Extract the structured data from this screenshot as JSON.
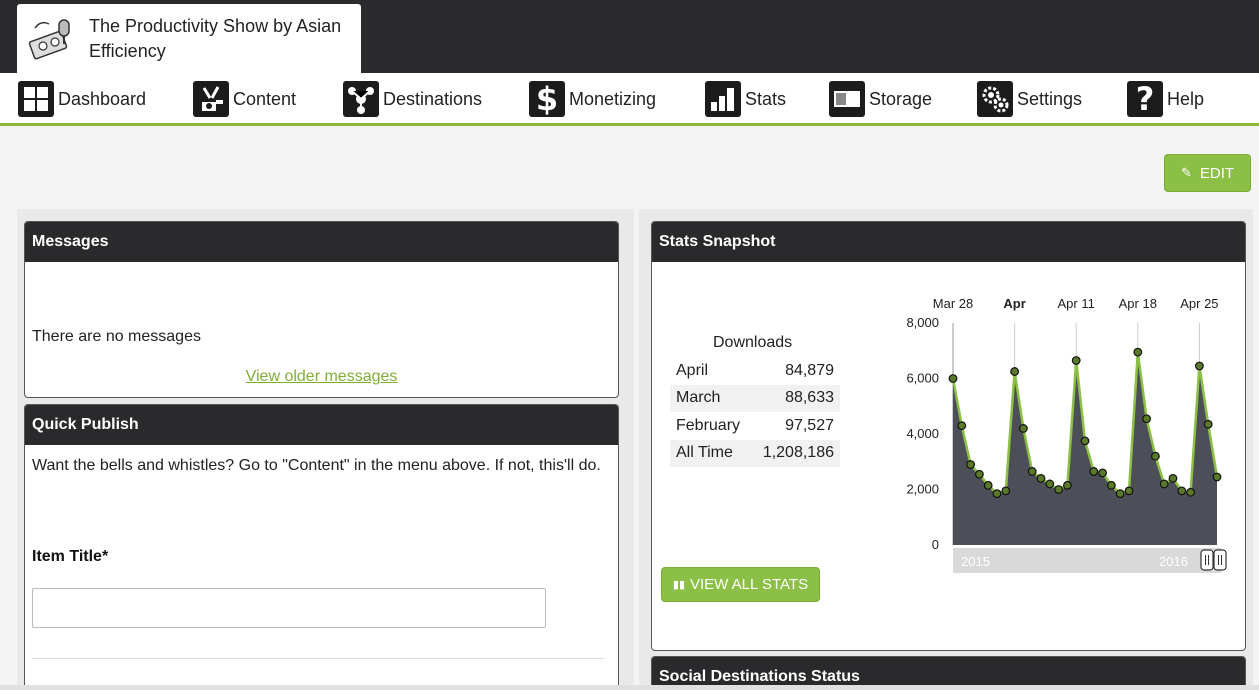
{
  "site": {
    "title": "The Productivity Show by Asian Efficiency",
    "logo_icon": "podcast-mixer-logo"
  },
  "nav": [
    {
      "label": "Dashboard",
      "icon": "dashboard-grid-icon"
    },
    {
      "label": "Content",
      "icon": "content-tools-icon"
    },
    {
      "label": "Destinations",
      "icon": "destinations-share-icon"
    },
    {
      "label": "Monetizing",
      "icon": "dollar-icon"
    },
    {
      "label": "Stats",
      "icon": "bar-chart-icon"
    },
    {
      "label": "Storage",
      "icon": "storage-battery-icon"
    },
    {
      "label": "Settings",
      "icon": "gears-icon"
    },
    {
      "label": "Help",
      "icon": "question-mark-icon"
    }
  ],
  "edit_button": {
    "label": "EDIT"
  },
  "messages": {
    "title": "Messages",
    "empty_text": "There are no messages",
    "older_link": "View older messages"
  },
  "quick_publish": {
    "title": "Quick Publish",
    "description": "Want the bells and whistles? Go to \"Content\" in the menu above. If not, this'll do.",
    "item_title_label": "Item Title*",
    "item_title_value": ""
  },
  "stats": {
    "title": "Stats Snapshot",
    "downloads_title": "Downloads",
    "rows": [
      {
        "label": "April",
        "value": "84,879"
      },
      {
        "label": "March",
        "value": "88,633"
      },
      {
        "label": "February",
        "value": "97,527"
      },
      {
        "label": "All Time",
        "value": "1,208,186"
      }
    ],
    "view_all_label": "VIEW ALL STATS"
  },
  "social": {
    "title": "Social Destinations Status"
  },
  "colors": {
    "accent": "#8cbf46",
    "header": "#2a2a2c",
    "chart_fill": "#4d4f58",
    "chart_line": "#8cbf46"
  },
  "chart_data": {
    "type": "area",
    "x_tick_labels": [
      "Mar 28",
      "Apr",
      "Apr 11",
      "Apr 18",
      "Apr 25"
    ],
    "x_tick_index": [
      0,
      7,
      14,
      21,
      28
    ],
    "bold_tick": "Apr",
    "ylim": [
      0,
      8000
    ],
    "y_ticks": [
      "0",
      "2,000",
      "4,000",
      "6,000",
      "8,000"
    ],
    "y_tick_values": [
      0,
      2000,
      4000,
      6000,
      8000
    ],
    "navigator_labels": [
      "2015",
      "2016"
    ],
    "values": [
      6000,
      4300,
      2900,
      2550,
      2150,
      1850,
      1950,
      6250,
      4200,
      2650,
      2400,
      2200,
      2000,
      2150,
      6650,
      3750,
      2650,
      2600,
      2150,
      1850,
      1950,
      6950,
      4550,
      3200,
      2200,
      2400,
      1950,
      1900,
      6450,
      4350,
      2450
    ],
    "grid": "vertical"
  }
}
